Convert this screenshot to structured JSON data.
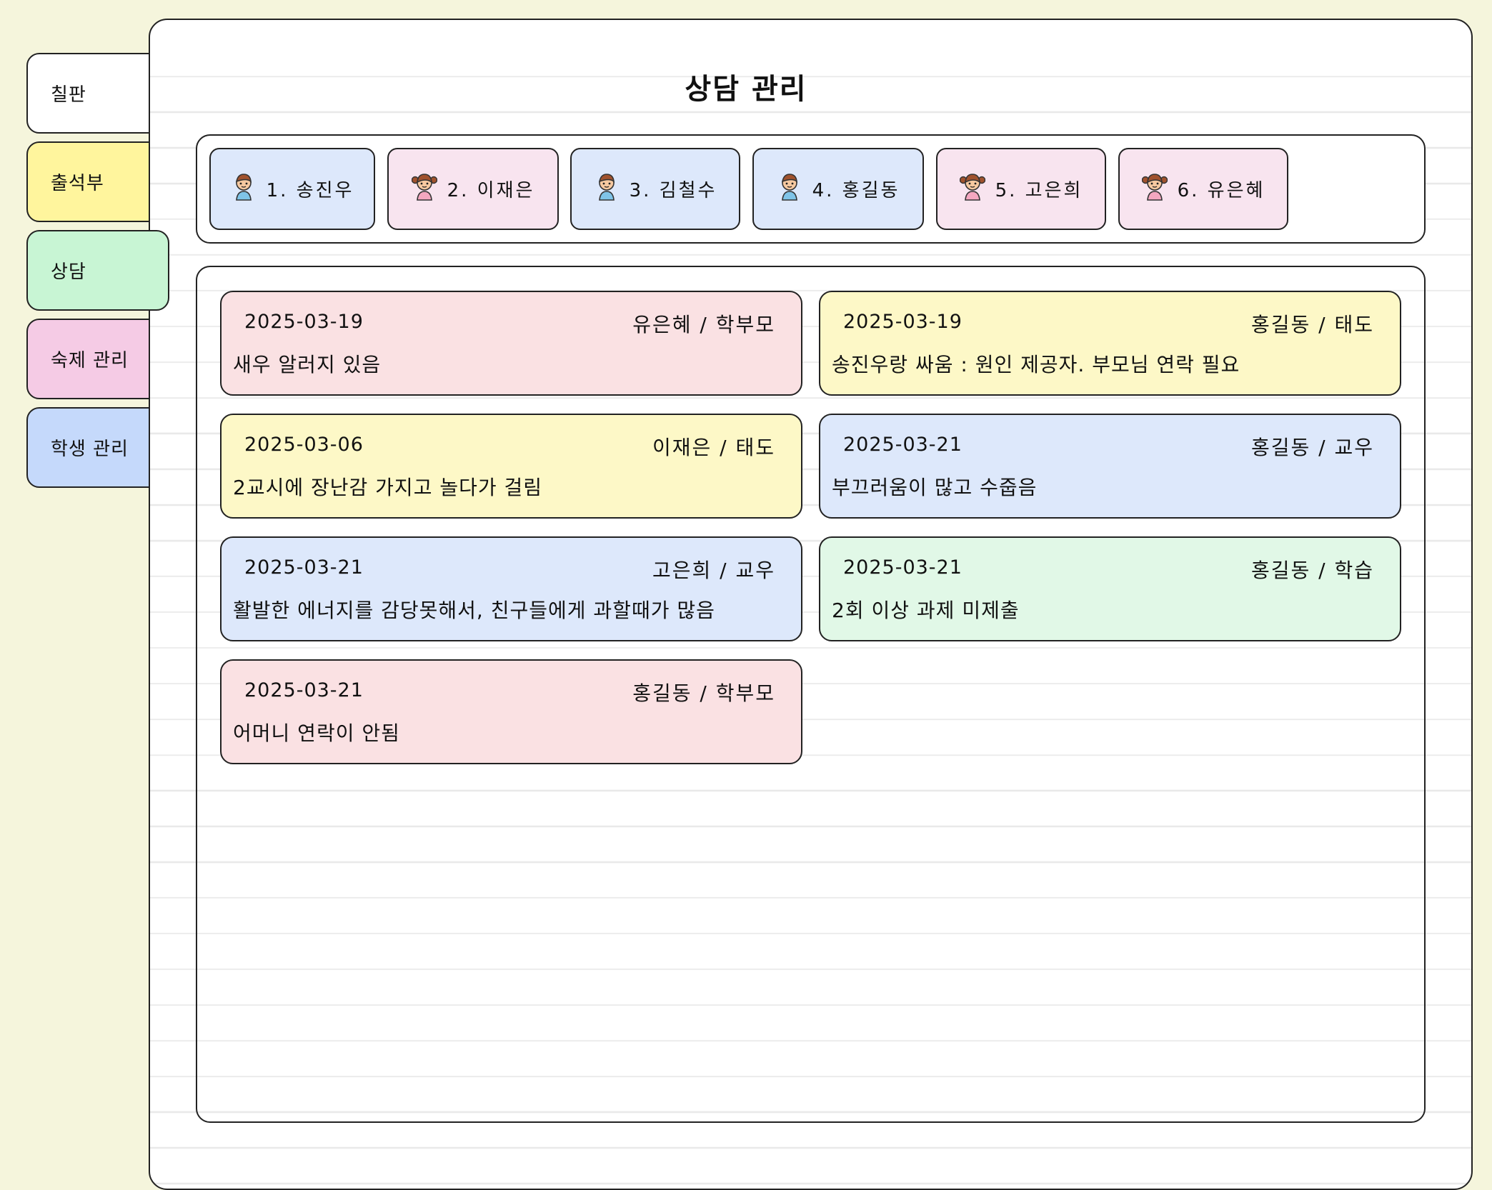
{
  "sidebar": {
    "tabs": [
      {
        "label": "칠판",
        "color": "#ffffff"
      },
      {
        "label": "출석부",
        "color": "#fff59d"
      },
      {
        "label": "상담",
        "color": "#c8f5d4"
      },
      {
        "label": "숙제 관리",
        "color": "#f5cbe5"
      },
      {
        "label": "학생 관리",
        "color": "#c5d9fb"
      }
    ],
    "active_tab": "상담"
  },
  "page": {
    "title": "상담 관리"
  },
  "students": [
    {
      "label": "1. 송진우",
      "gender": "boy",
      "color": "#dde8fb",
      "icon": "boy-icon"
    },
    {
      "label": "2. 이재은",
      "gender": "girl",
      "color": "#f8e4ef",
      "icon": "girl-icon"
    },
    {
      "label": "3. 김철수",
      "gender": "boy",
      "color": "#dde8fb",
      "icon": "boy-icon"
    },
    {
      "label": "4. 홍길동",
      "gender": "boy",
      "color": "#dde8fb",
      "icon": "boy-icon"
    },
    {
      "label": "5. 고은희",
      "gender": "girl",
      "color": "#f8e4ef",
      "icon": "girl-icon"
    },
    {
      "label": "6. 유은혜",
      "gender": "girl",
      "color": "#f8e4ef",
      "icon": "girl-icon"
    }
  ],
  "records": [
    {
      "date": "2025-03-19",
      "who": "유은혜 / 학부모",
      "memo": "새우 알러지 있음",
      "color": "#fae1e3"
    },
    {
      "date": "2025-03-19",
      "who": "홍길동 / 태도",
      "memo": "송진우랑 싸움 : 원인 제공자. 부모님 연락 필요",
      "color": "#fdf8c7"
    },
    {
      "date": "2025-03-06",
      "who": "이재은 / 태도",
      "memo": "2교시에 장난감 가지고 놀다가 걸림",
      "color": "#fdf8c7"
    },
    {
      "date": "2025-03-21",
      "who": "홍길동 / 교우",
      "memo": "부끄러움이 많고 수줍음",
      "color": "#dde8fb"
    },
    {
      "date": "2025-03-21",
      "who": "고은희 / 교우",
      "memo": "활발한 에너지를 감당못해서, 친구들에게 과할때가 많음",
      "color": "#dde8fb"
    },
    {
      "date": "2025-03-21",
      "who": "홍길동 / 학습",
      "memo": "2회 이상 과제 미제출",
      "color": "#e1f8e7"
    },
    {
      "date": "2025-03-21",
      "who": "홍길동 / 학부모",
      "memo": "어머니 연락이 안됨",
      "color": "#fae1e3"
    }
  ]
}
